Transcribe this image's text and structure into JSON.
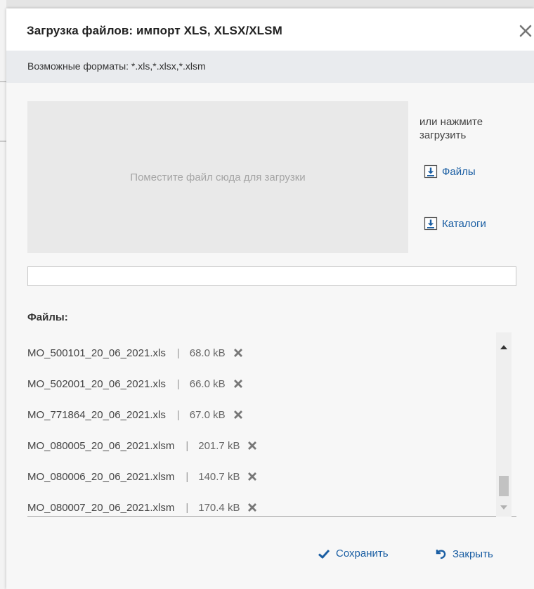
{
  "dialog": {
    "title": "Загрузка файлов: импорт XLS, XLSX/XLSM",
    "formats": "Возможные форматы: *.xls,*.xlsx,*.xlsm"
  },
  "upload": {
    "dropzone_text": "Поместите файл сюда для загрузки",
    "or_text": "или нажмите загрузить",
    "files_link": "Файлы",
    "folders_link": "Каталоги"
  },
  "files": {
    "label": "Файлы:",
    "separator": "|",
    "items": [
      {
        "name": "MO_500101_20_06_2021.xls",
        "size": "68.0 kB"
      },
      {
        "name": "MO_502001_20_06_2021.xls",
        "size": "66.0 kB"
      },
      {
        "name": "MO_771864_20_06_2021.xls",
        "size": "67.0 kB"
      },
      {
        "name": "MO_080005_20_06_2021.xlsm",
        "size": "201.7 kB"
      },
      {
        "name": "MO_080006_20_06_2021.xlsm",
        "size": "140.7 kB"
      },
      {
        "name": "MO_080007_20_06_2021.xlsm",
        "size": "170.4 kB"
      }
    ]
  },
  "actions": {
    "save": "Сохранить",
    "close": "Закрыть"
  },
  "colors": {
    "link": "#1a5ea3",
    "dropzone": "#e9e9e9",
    "formats_bar": "#e9ebee",
    "remove_icon": "#777777"
  }
}
